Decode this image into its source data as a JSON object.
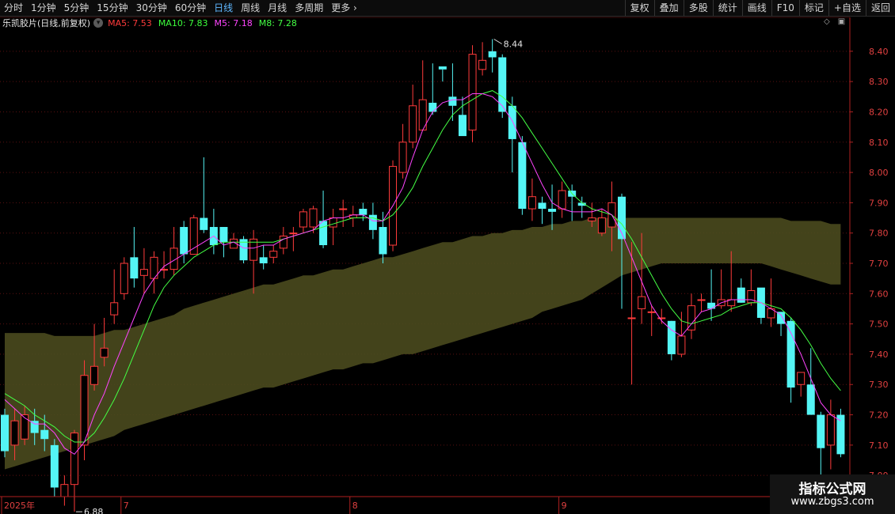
{
  "toolbar": {
    "periods": [
      "分时",
      "1分钟",
      "5分钟",
      "15分钟",
      "30分钟",
      "60分钟",
      "日线",
      "周线",
      "月线",
      "多周期",
      "更多"
    ],
    "active_period": "日线",
    "actions": [
      "复权",
      "叠加",
      "多股",
      "统计",
      "画线",
      "F10",
      "标记",
      "+自选",
      "返回"
    ]
  },
  "stock": {
    "title": "乐凯胶片(日线,前复权)",
    "ma": [
      {
        "label": "MA5: 7.53",
        "color": "#ff3b3b"
      },
      {
        "label": "MA10: 7.83",
        "color": "#3cff3c"
      },
      {
        "label": "M5: 7.18",
        "color": "#ff44ff"
      },
      {
        "label": "M8: 7.28",
        "color": "#44ff44"
      }
    ]
  },
  "colors": {
    "up": "#ff3b3b",
    "down": "#54f5f5",
    "band": "#4a4a1e",
    "m5": "#ff44ff",
    "m8": "#44ff44"
  },
  "axis": {
    "y_ticks": [
      "8.40",
      "8.30",
      "8.20",
      "8.10",
      "8.00",
      "7.90",
      "7.80",
      "7.70",
      "7.60",
      "7.50",
      "7.40",
      "7.30",
      "7.20",
      "7.10",
      "7.00"
    ],
    "x_labels": [
      {
        "text": "2025年",
        "index": 0
      },
      {
        "text": "7",
        "index": 12
      },
      {
        "text": "8",
        "index": 35
      },
      {
        "text": "9",
        "index": 56
      }
    ]
  },
  "annotations": {
    "high": "8.44",
    "low": "6.88"
  },
  "chart_data": {
    "type": "candlestick",
    "ylim": [
      6.93,
      8.47
    ],
    "candles": [
      [
        7.2,
        7.08,
        7.22,
        7.06
      ],
      [
        7.1,
        7.18,
        7.22,
        7.05
      ],
      [
        7.12,
        7.2,
        7.23,
        7.1
      ],
      [
        7.18,
        7.14,
        7.22,
        7.1
      ],
      [
        7.15,
        7.12,
        7.2,
        7.08
      ],
      [
        7.1,
        6.96,
        7.12,
        6.93
      ],
      [
        6.93,
        6.97,
        7.0,
        6.9
      ],
      [
        6.97,
        7.14,
        7.15,
        6.88
      ],
      [
        7.1,
        7.33,
        7.38,
        7.05
      ],
      [
        7.3,
        7.36,
        7.5,
        7.28
      ],
      [
        7.39,
        7.42,
        7.52,
        7.36
      ],
      [
        7.53,
        7.57,
        7.68,
        7.5
      ],
      [
        7.6,
        7.7,
        7.72,
        7.58
      ],
      [
        7.72,
        7.65,
        7.82,
        7.62
      ],
      [
        7.66,
        7.68,
        7.75,
        7.6
      ],
      [
        7.65,
        7.72,
        7.74,
        7.6
      ],
      [
        7.68,
        7.68,
        7.74,
        7.65
      ],
      [
        7.68,
        7.75,
        7.82,
        7.66
      ],
      [
        7.82,
        7.73,
        7.84,
        7.7
      ],
      [
        7.73,
        7.85,
        7.86,
        7.73
      ],
      [
        7.85,
        7.81,
        8.05,
        7.8
      ],
      [
        7.82,
        7.76,
        7.88,
        7.73
      ],
      [
        7.82,
        7.77,
        7.82,
        7.72
      ],
      [
        7.75,
        7.78,
        7.8,
        7.75
      ],
      [
        7.78,
        7.71,
        7.79,
        7.7
      ],
      [
        7.71,
        7.78,
        7.81,
        7.6
      ],
      [
        7.72,
        7.7,
        7.76,
        7.68
      ],
      [
        7.72,
        7.74,
        7.76,
        7.7
      ],
      [
        7.75,
        7.79,
        7.82,
        7.73
      ],
      [
        7.8,
        7.8,
        7.82,
        7.74
      ],
      [
        7.82,
        7.87,
        7.88,
        7.8
      ],
      [
        7.82,
        7.88,
        7.89,
        7.8
      ],
      [
        7.84,
        7.76,
        7.94,
        7.75
      ],
      [
        7.82,
        7.85,
        7.88,
        7.76
      ],
      [
        7.88,
        7.88,
        7.91,
        7.82
      ],
      [
        7.85,
        7.86,
        7.89,
        7.82
      ],
      [
        7.88,
        7.86,
        7.9,
        7.84
      ],
      [
        7.86,
        7.81,
        7.9,
        7.78
      ],
      [
        7.82,
        7.73,
        7.87,
        7.7
      ],
      [
        7.76,
        8.02,
        8.04,
        7.74
      ],
      [
        8.0,
        8.1,
        8.16,
        7.98
      ],
      [
        8.1,
        8.22,
        8.29,
        8.08
      ],
      [
        8.14,
        8.24,
        8.37,
        8.14
      ],
      [
        8.23,
        8.2,
        8.36,
        8.19
      ],
      [
        8.35,
        8.34,
        8.3,
        8.34
      ],
      [
        8.25,
        8.22,
        8.36,
        8.17
      ],
      [
        8.19,
        8.12,
        8.25,
        8.17
      ],
      [
        8.14,
        8.39,
        8.42,
        8.1
      ],
      [
        8.34,
        8.37,
        8.43,
        8.32
      ],
      [
        8.4,
        8.38,
        8.44,
        8.33
      ],
      [
        8.38,
        8.2,
        8.39,
        8.18
      ],
      [
        8.22,
        8.11,
        8.25,
        8.0
      ],
      [
        8.1,
        7.88,
        8.12,
        7.86
      ],
      [
        7.88,
        7.92,
        7.98,
        7.84
      ],
      [
        7.9,
        7.88,
        7.92,
        7.83
      ],
      [
        7.88,
        7.87,
        7.96,
        7.81
      ],
      [
        7.88,
        7.94,
        7.97,
        7.85
      ],
      [
        7.94,
        7.92,
        7.96,
        7.84
      ],
      [
        7.9,
        7.89,
        7.92,
        7.85
      ],
      [
        7.84,
        7.85,
        7.9,
        7.82
      ],
      [
        7.8,
        7.85,
        7.88,
        7.79
      ],
      [
        7.82,
        7.9,
        7.97,
        7.74
      ],
      [
        7.92,
        7.78,
        7.93,
        7.55
      ],
      [
        7.52,
        7.52,
        7.77,
        7.3
      ],
      [
        7.55,
        7.59,
        7.8,
        7.5
      ],
      [
        7.54,
        7.54,
        7.56,
        7.46
      ],
      [
        7.52,
        7.52,
        7.55,
        7.5
      ],
      [
        7.51,
        7.4,
        7.51,
        7.38
      ],
      [
        7.4,
        7.46,
        7.54,
        7.39
      ],
      [
        7.48,
        7.56,
        7.6,
        7.45
      ],
      [
        7.58,
        7.58,
        7.6,
        7.54
      ],
      [
        7.57,
        7.55,
        7.68,
        7.51
      ],
      [
        7.56,
        7.58,
        7.68,
        7.55
      ],
      [
        7.56,
        7.58,
        7.74,
        7.54
      ],
      [
        7.62,
        7.57,
        7.65,
        7.57
      ],
      [
        7.57,
        7.61,
        7.68,
        7.56
      ],
      [
        7.62,
        7.52,
        7.58,
        7.5
      ],
      [
        7.52,
        7.55,
        7.65,
        7.49
      ],
      [
        7.54,
        7.5,
        7.52,
        7.46
      ],
      [
        7.51,
        7.29,
        7.52,
        7.24
      ],
      [
        7.3,
        7.34,
        7.32,
        7.26
      ],
      [
        7.3,
        7.2,
        7.42,
        7.2
      ],
      [
        7.2,
        7.09,
        7.21,
        6.94
      ],
      [
        7.1,
        7.2,
        7.25,
        7.02
      ],
      [
        7.2,
        7.07,
        7.22,
        7.06
      ]
    ],
    "m5": [
      7.25,
      7.22,
      7.19,
      7.17,
      7.17,
      7.14,
      7.09,
      7.07,
      7.11,
      7.2,
      7.27,
      7.36,
      7.44,
      7.52,
      7.6,
      7.65,
      7.69,
      7.71,
      7.73,
      7.75,
      7.77,
      7.79,
      7.76,
      7.77,
      7.75,
      7.75,
      7.76,
      7.76,
      7.78,
      7.79,
      7.8,
      7.81,
      7.84,
      7.85,
      7.85,
      7.86,
      7.86,
      7.84,
      7.84,
      7.89,
      7.95,
      8.05,
      8.14,
      8.2,
      8.23,
      8.24,
      8.24,
      8.26,
      8.26,
      8.25,
      8.22,
      8.17,
      8.1,
      8.03,
      7.96,
      7.9,
      7.88,
      7.87,
      7.87,
      7.87,
      7.88,
      7.86,
      7.8,
      7.72,
      7.64,
      7.56,
      7.51,
      7.48,
      7.46,
      7.5,
      7.54,
      7.55,
      7.57,
      7.58,
      7.58,
      7.58,
      7.57,
      7.55,
      7.53,
      7.47,
      7.4,
      7.32,
      7.24,
      7.2,
      7.18
    ],
    "m8": [
      7.27,
      7.25,
      7.23,
      7.2,
      7.18,
      7.16,
      7.13,
      7.11,
      7.11,
      7.14,
      7.19,
      7.25,
      7.32,
      7.4,
      7.48,
      7.56,
      7.62,
      7.66,
      7.69,
      7.72,
      7.74,
      7.76,
      7.77,
      7.77,
      7.77,
      7.77,
      7.77,
      7.77,
      7.78,
      7.79,
      7.8,
      7.81,
      7.82,
      7.83,
      7.84,
      7.85,
      7.85,
      7.85,
      7.84,
      7.86,
      7.9,
      7.95,
      8.02,
      8.08,
      8.14,
      8.19,
      8.22,
      8.24,
      8.26,
      8.27,
      8.25,
      8.22,
      8.18,
      8.13,
      8.08,
      8.03,
      7.98,
      7.93,
      7.9,
      7.88,
      7.87,
      7.86,
      7.83,
      7.78,
      7.72,
      7.66,
      7.6,
      7.55,
      7.51,
      7.5,
      7.51,
      7.52,
      7.53,
      7.55,
      7.56,
      7.57,
      7.57,
      7.56,
      7.55,
      7.52,
      7.48,
      7.43,
      7.37,
      7.32,
      7.28
    ],
    "band_upper": [
      7.47,
      7.47,
      7.47,
      7.47,
      7.47,
      7.46,
      7.46,
      7.46,
      7.46,
      7.46,
      7.47,
      7.48,
      7.48,
      7.49,
      7.5,
      7.51,
      7.52,
      7.53,
      7.55,
      7.56,
      7.57,
      7.58,
      7.59,
      7.6,
      7.61,
      7.62,
      7.63,
      7.63,
      7.64,
      7.65,
      7.66,
      7.66,
      7.67,
      7.68,
      7.68,
      7.69,
      7.7,
      7.71,
      7.72,
      7.72,
      7.73,
      7.74,
      7.75,
      7.76,
      7.77,
      7.77,
      7.78,
      7.79,
      7.79,
      7.8,
      7.8,
      7.81,
      7.81,
      7.82,
      7.82,
      7.83,
      7.83,
      7.84,
      7.84,
      7.85,
      7.85,
      7.85,
      7.85,
      7.85,
      7.85,
      7.85,
      7.85,
      7.85,
      7.85,
      7.85,
      7.85,
      7.85,
      7.85,
      7.85,
      7.85,
      7.85,
      7.85,
      7.85,
      7.85,
      7.84,
      7.84,
      7.84,
      7.84,
      7.83,
      7.83
    ],
    "band_lower": [
      7.02,
      7.03,
      7.04,
      7.05,
      7.06,
      7.07,
      7.08,
      7.09,
      7.1,
      7.11,
      7.12,
      7.13,
      7.15,
      7.16,
      7.17,
      7.18,
      7.19,
      7.2,
      7.21,
      7.22,
      7.23,
      7.24,
      7.25,
      7.26,
      7.27,
      7.28,
      7.29,
      7.29,
      7.3,
      7.31,
      7.32,
      7.33,
      7.34,
      7.35,
      7.35,
      7.36,
      7.37,
      7.37,
      7.38,
      7.39,
      7.4,
      7.4,
      7.41,
      7.42,
      7.43,
      7.44,
      7.45,
      7.46,
      7.47,
      7.48,
      7.49,
      7.5,
      7.51,
      7.52,
      7.54,
      7.55,
      7.56,
      7.57,
      7.58,
      7.6,
      7.62,
      7.64,
      7.66,
      7.67,
      7.68,
      7.69,
      7.7,
      7.7,
      7.7,
      7.7,
      7.7,
      7.7,
      7.7,
      7.7,
      7.7,
      7.7,
      7.7,
      7.69,
      7.68,
      7.67,
      7.66,
      7.65,
      7.64,
      7.63,
      7.63
    ]
  },
  "watermark": {
    "line1": "指标公式网",
    "line2": "www.zbgs3.com"
  }
}
